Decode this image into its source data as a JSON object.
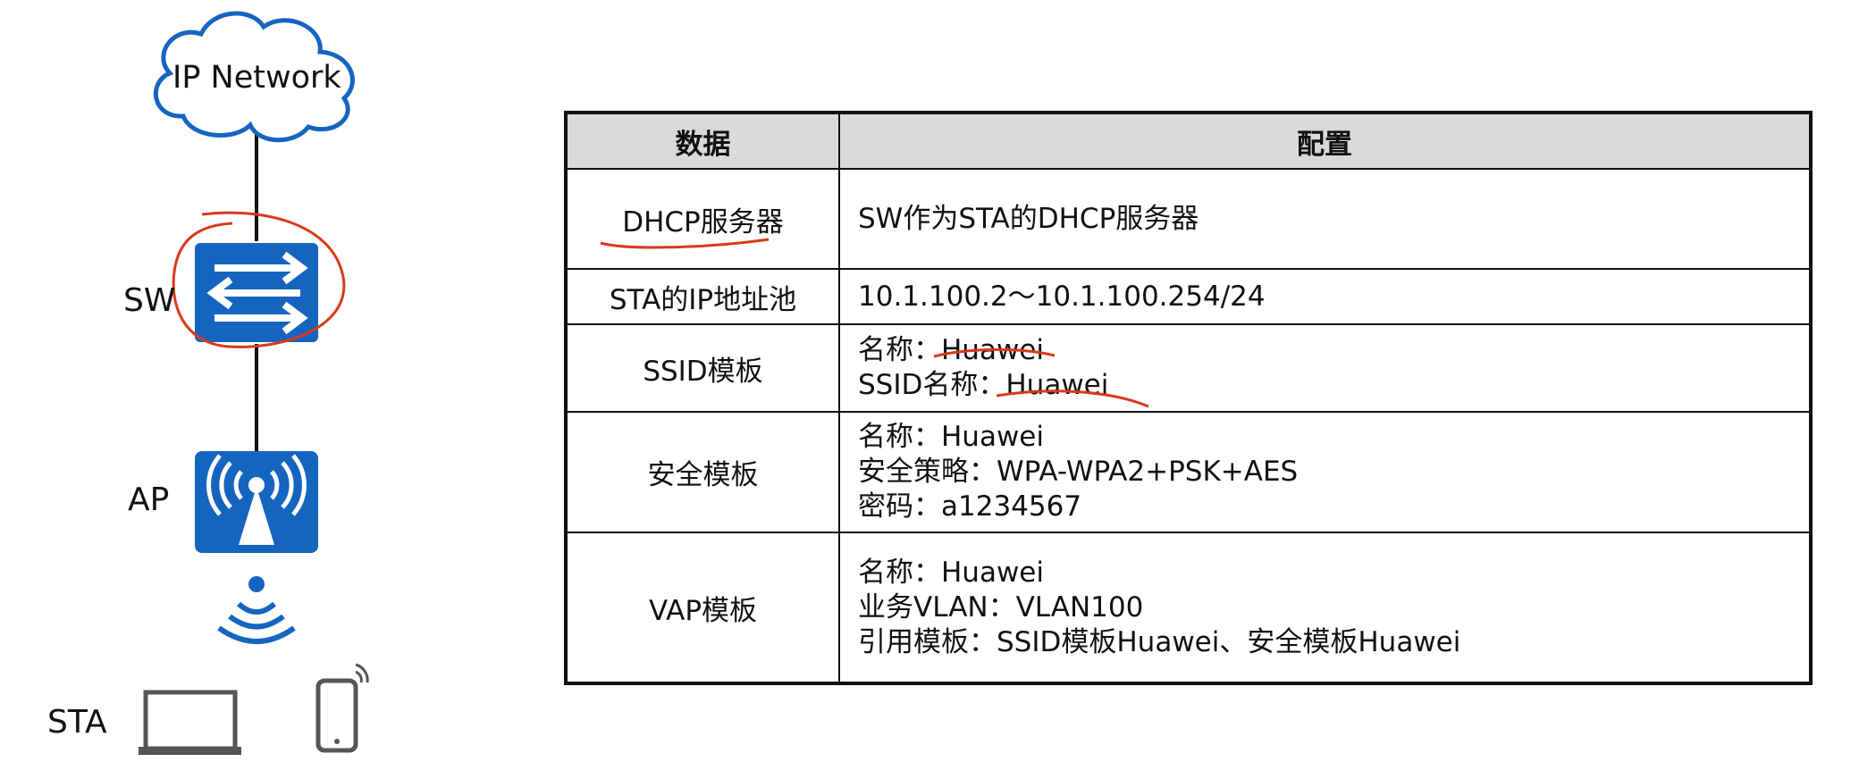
{
  "topology": {
    "cloud_label": "IP Network",
    "sw_label": "SW",
    "ap_label": "AP",
    "sta_label": "STA",
    "icons": [
      "cloud-icon",
      "switch-icon",
      "ap-icon",
      "wireless-signal-icon",
      "laptop-icon",
      "smartphone-icon"
    ],
    "colors": {
      "device_blue": "#1565c0",
      "link": "#111111",
      "cloud_outline": "#1565c0",
      "annotation_red": "#d9391b"
    }
  },
  "table": {
    "headers": {
      "data": "数据",
      "config": "配置"
    },
    "rows": [
      {
        "name": "DHCP服务器",
        "lines": [
          "SW作为STA的DHCP服务器"
        ]
      },
      {
        "name": "STA的IP地址池",
        "lines": [
          "10.1.100.2～10.1.100.254/24"
        ]
      },
      {
        "name": "SSID模板",
        "lines": [
          "名称：Huawei",
          "SSID名称：Huawei"
        ]
      },
      {
        "name": "安全模板",
        "lines": [
          "名称：Huawei",
          "安全策略：WPA-WPA2+PSK+AES",
          "密码：a1234567"
        ]
      },
      {
        "name": "VAP模板",
        "lines": [
          "名称：Huawei",
          "业务VLAN：VLAN100",
          "引用模板：SSID模板Huawei、安全模板Huawei"
        ]
      }
    ],
    "header_bg": "#d9d9d9"
  }
}
